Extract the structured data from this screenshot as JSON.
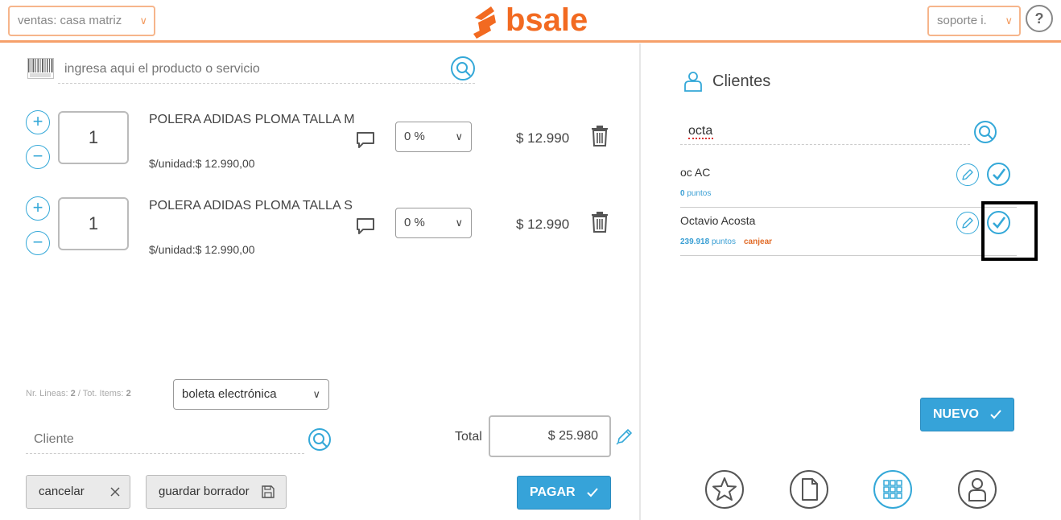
{
  "header": {
    "branch_select": "ventas: casa matriz",
    "logo_text": "bsale",
    "user_select": "soporte i.",
    "help_label": "?"
  },
  "sale": {
    "product_search_placeholder": "ingresa aqui el producto o servicio",
    "items": [
      {
        "qty": "1",
        "name": "POLERA ADIDAS PLOMA TALLA M",
        "unit_price": "$/unidad:$ 12.990,00",
        "discount": "0 %",
        "price": "$ 12.990"
      },
      {
        "qty": "1",
        "name": "POLERA ADIDAS PLOMA TALLA S",
        "unit_price": "$/unidad:$ 12.990,00",
        "discount": "0 %",
        "price": "$ 12.990"
      }
    ],
    "lines_label": "Nr. Lineas:",
    "lines_count": "2",
    "items_label": "/ Tot. Items:",
    "items_count": "2",
    "doc_type": "boleta electrónica",
    "client_placeholder": "Cliente",
    "total_label": "Total",
    "total_value": "$ 25.980",
    "cancel_label": "cancelar",
    "save_draft_label": "guardar borrador",
    "pay_label": "PAGAR"
  },
  "clients": {
    "title": "Clientes",
    "search_value": "octa",
    "results": [
      {
        "name": "oc AC",
        "points_value": "0",
        "points_label": "puntos",
        "redeem": ""
      },
      {
        "name": "Octavio Acosta",
        "points_value": "239.918",
        "points_label": "puntos",
        "redeem": "canjear"
      }
    ],
    "new_label": "NUEVO"
  },
  "bottom_nav": {
    "items": [
      "star-icon",
      "document-icon",
      "grid-icon",
      "user-icon"
    ],
    "active": "grid-icon"
  },
  "colors": {
    "accent_blue": "#36a3d9",
    "brand_orange": "#f26a21",
    "header_line": "#f6a06a"
  }
}
